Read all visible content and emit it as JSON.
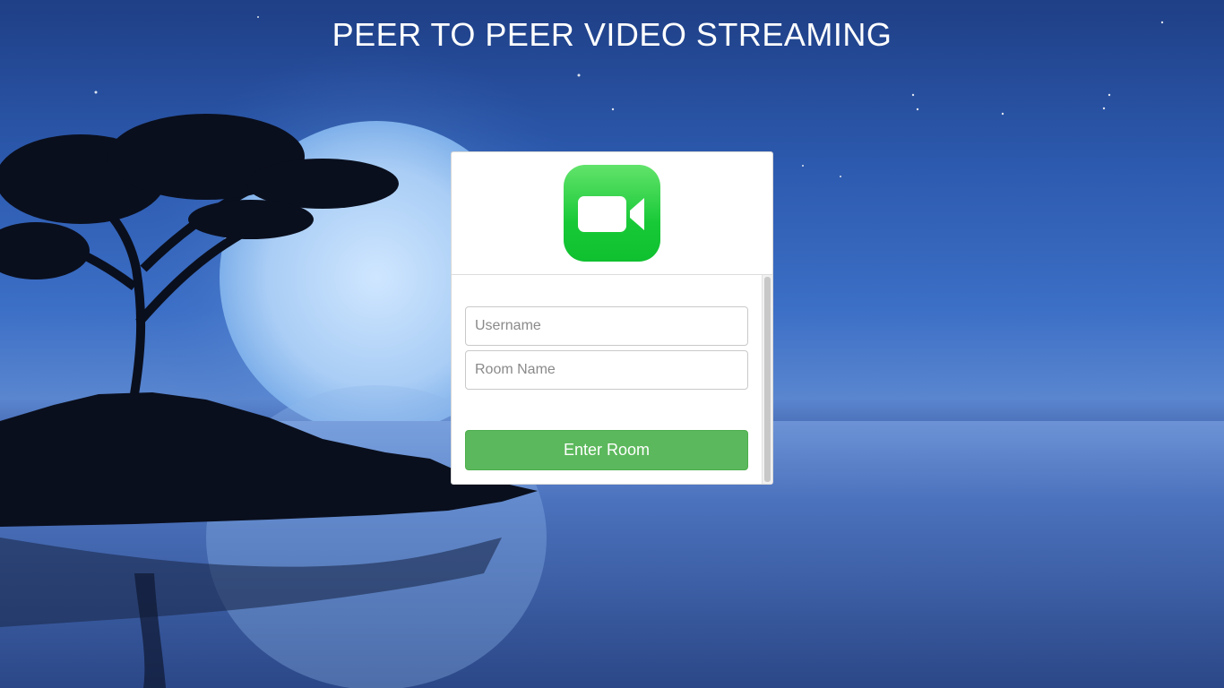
{
  "page": {
    "title": "PEER TO PEER VIDEO STREAMING"
  },
  "logo": {
    "icon": "video-camera-icon",
    "color": "#18c937"
  },
  "form": {
    "username_placeholder": "Username",
    "username_value": "",
    "room_placeholder": "Room Name",
    "room_value": "",
    "submit_label": "Enter Room",
    "submit_color": "#5cb85c"
  }
}
